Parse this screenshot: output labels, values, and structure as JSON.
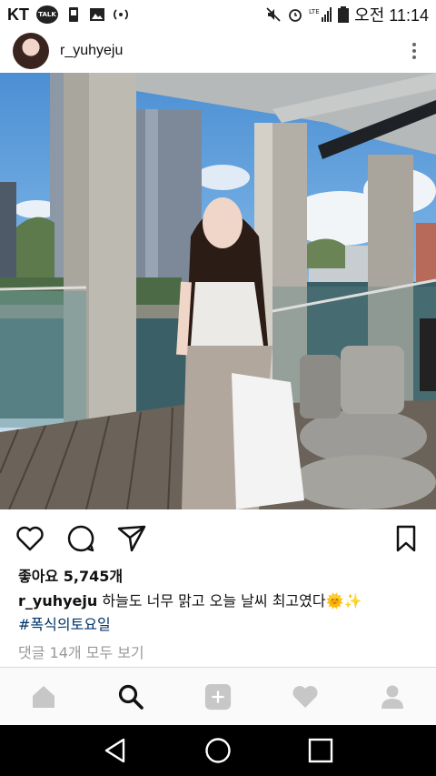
{
  "status_bar": {
    "carrier": "KT",
    "talk_badge": "TALK",
    "clock": "오전 11:14",
    "icons": [
      "talk-icon",
      "sim-icon",
      "gallery-icon",
      "hotspot-icon",
      "mute-icon",
      "alarm-icon",
      "lte-signal-icon",
      "battery-icon"
    ]
  },
  "post": {
    "username": "r_yuhyeju",
    "likes": "좋아요 5,745개",
    "caption_user": "r_yuhyeju",
    "caption_text": " 하늘도 너무 맑고 오늘 날씨 최고였다🌞✨",
    "hashtag": "#폭식의토요일",
    "comments_link": "댓글 14개 모두 보기"
  },
  "actions": [
    "heart-icon",
    "comment-icon",
    "share-icon",
    "bookmark-icon"
  ],
  "bottom_nav": [
    "home-icon",
    "search-icon",
    "add-icon",
    "activity-icon",
    "profile-icon"
  ],
  "system_nav": [
    "back-icon",
    "home-circle-icon",
    "recents-icon"
  ],
  "colors": {
    "hashtag": "#003569",
    "muted": "#999999",
    "nav_bg": "#fafafa"
  }
}
